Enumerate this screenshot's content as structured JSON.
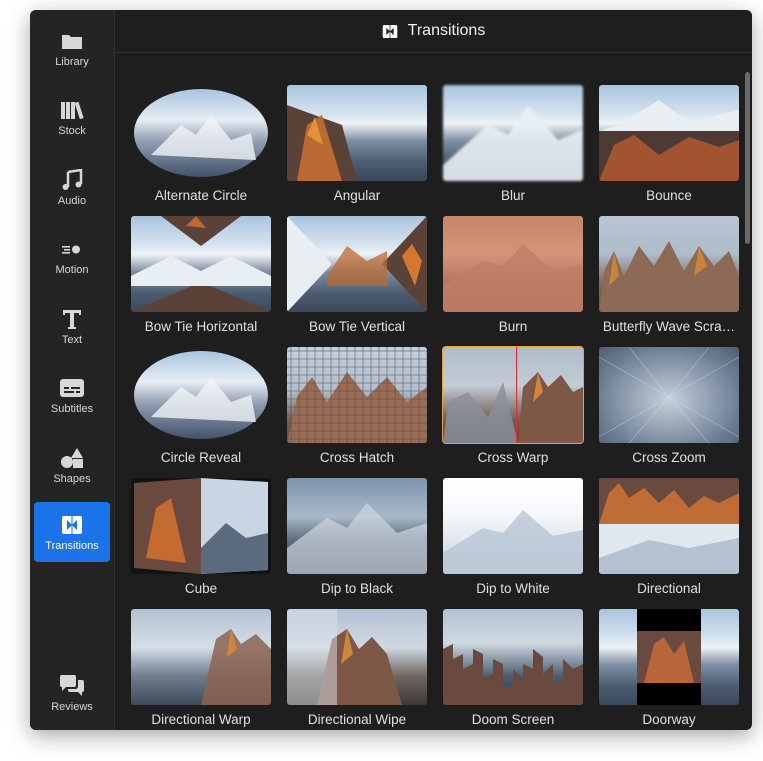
{
  "sidebar": {
    "items": [
      {
        "label": "Library",
        "icon": "folder-icon"
      },
      {
        "label": "Stock",
        "icon": "books-icon"
      },
      {
        "label": "Audio",
        "icon": "music-note-icon"
      },
      {
        "label": "Motion",
        "icon": "motion-icon"
      },
      {
        "label": "Text",
        "icon": "text-icon"
      },
      {
        "label": "Subtitles",
        "icon": "subtitles-icon"
      },
      {
        "label": "Shapes",
        "icon": "shapes-icon"
      },
      {
        "label": "Transitions",
        "icon": "transitions-icon",
        "active": true
      },
      {
        "label": "Reviews",
        "icon": "reviews-icon"
      }
    ]
  },
  "header": {
    "title": "Transitions",
    "icon": "transitions-icon"
  },
  "transitions": [
    {
      "name": "Alternate Circle"
    },
    {
      "name": "Angular"
    },
    {
      "name": "Blur"
    },
    {
      "name": "Bounce"
    },
    {
      "name": "Bow Tie Horizontal"
    },
    {
      "name": "Bow Tie Vertical"
    },
    {
      "name": "Burn"
    },
    {
      "name": "Butterfly Wave Scra…"
    },
    {
      "name": "Circle Reveal"
    },
    {
      "name": "Cross Hatch"
    },
    {
      "name": "Cross Warp",
      "selected": true
    },
    {
      "name": "Cross Zoom"
    },
    {
      "name": "Cube"
    },
    {
      "name": "Dip to Black"
    },
    {
      "name": "Dip to White"
    },
    {
      "name": "Directional"
    },
    {
      "name": "Directional Warp"
    },
    {
      "name": "Directional Wipe"
    },
    {
      "name": "Doom Screen"
    },
    {
      "name": "Doorway"
    }
  ],
  "colors": {
    "accent": "#1a73e8",
    "selected_outline": "#e8a33a",
    "background": "#1e1e1e"
  }
}
